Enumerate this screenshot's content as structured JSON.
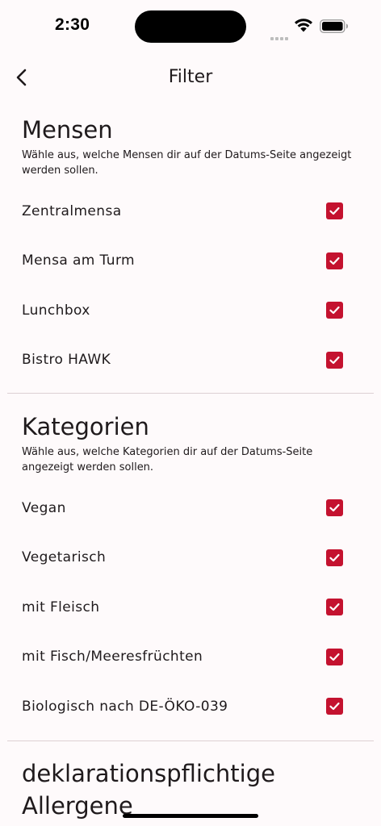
{
  "status_bar": {
    "time": "2:30"
  },
  "nav": {
    "title": "Filter"
  },
  "mensen": {
    "title": "Mensen",
    "description": "Wähle aus, welche Mensen dir auf der Datums-Seite angezeigt werden sollen.",
    "items": [
      {
        "label": "Zentralmensa",
        "checked": true
      },
      {
        "label": "Mensa am Turm",
        "checked": true
      },
      {
        "label": "Lunchbox",
        "checked": true
      },
      {
        "label": "Bistro HAWK",
        "checked": true
      }
    ]
  },
  "kategorien": {
    "title": "Kategorien",
    "description": "Wähle aus, welche Kategorien dir auf der  Datums-Seite angezeigt werden sollen.",
    "items": [
      {
        "label": "Vegan",
        "checked": true
      },
      {
        "label": "Vegetarisch",
        "checked": true
      },
      {
        "label": "mit Fleisch",
        "checked": true
      },
      {
        "label": "mit Fisch/Meeresfrüchten",
        "checked": true
      },
      {
        "label": "Biologisch nach DE-ÖKO-039",
        "checked": true
      }
    ]
  },
  "allergene": {
    "title": "deklarationspflichtige Allergene"
  },
  "colors": {
    "accent": "#c4122f",
    "background": "#fefafb",
    "divider": "#ddd0d3"
  }
}
